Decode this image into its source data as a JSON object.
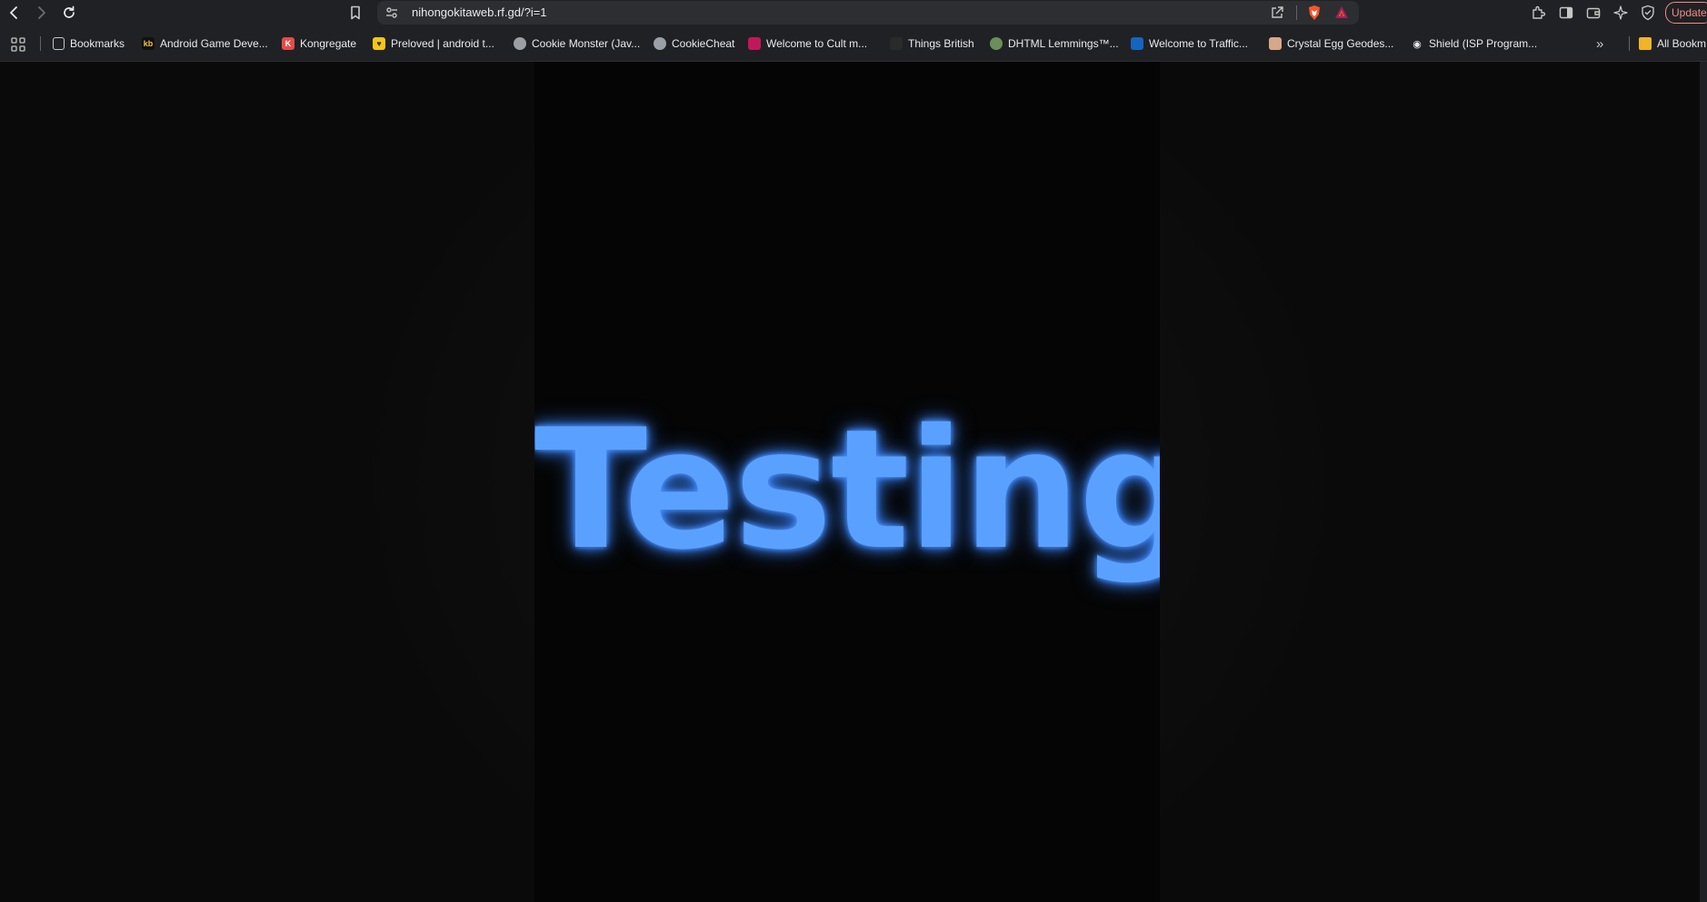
{
  "browser": {
    "url": "nihongokitaweb.rf.gd/?i=1",
    "update_label": "Update",
    "colors": {
      "toolbar_bg": "#202124",
      "omnibox_bg": "#2d2e31",
      "update_accent": "#f28b82"
    }
  },
  "bookmarks": {
    "items": [
      {
        "label": "Bookmarks",
        "icon": "bookmarks-icon"
      },
      {
        "label": "Android Game Deve...",
        "icon": "kb-icon"
      },
      {
        "label": "Kongregate",
        "icon": "kongregate-icon"
      },
      {
        "label": "Preloved | android t...",
        "icon": "preloved-icon"
      },
      {
        "label": "Cookie Monster (Jav...",
        "icon": "globe-icon"
      },
      {
        "label": "CookieCheat",
        "icon": "globe-icon"
      },
      {
        "label": "Welcome to Cult m...",
        "icon": "cult-icon"
      },
      {
        "label": "Things British",
        "icon": "things-british-icon"
      },
      {
        "label": "DHTML Lemmings™...",
        "icon": "lemmings-icon"
      },
      {
        "label": "Welcome to Traffic...",
        "icon": "traffic-icon"
      },
      {
        "label": "Crystal Egg Geodes...",
        "icon": "crystal-egg-icon"
      },
      {
        "label": "Shield (ISP Program...",
        "icon": "shield-icon"
      }
    ],
    "overflow_label": "»",
    "all_bookmarks_label": "All Bookm"
  },
  "page": {
    "heading": "Testing",
    "glow_color": "#5aa1ff"
  }
}
